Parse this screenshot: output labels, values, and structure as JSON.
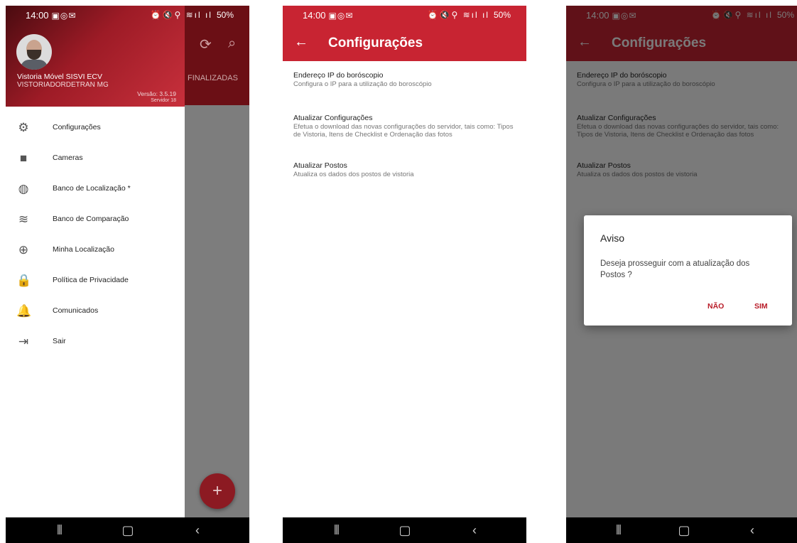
{
  "status": {
    "time": "14:00",
    "left_glyphs": "▣◎✉",
    "right_glyphs": "⏰🔇⚲ ≋ıl ıl",
    "battery": "50%"
  },
  "drawer": {
    "user_name": "Vistoria Móvel SISVI ECV",
    "user_org": "VISTORIADORDETRAN MG",
    "version": "Versão: 3.5.19",
    "server": "Servidor 18",
    "items": [
      {
        "label": "Configurações",
        "icon": "gear-icon",
        "glyph": "⚙"
      },
      {
        "label": "Cameras",
        "icon": "video-camera-icon",
        "glyph": "■"
      },
      {
        "label": "Banco de Localização *",
        "icon": "globe-icon",
        "glyph": "◍"
      },
      {
        "label": "Banco de Comparação",
        "icon": "database-icon",
        "glyph": "≋"
      },
      {
        "label": "Minha Localização",
        "icon": "crosshair-icon",
        "glyph": "⊕"
      },
      {
        "label": "Política de Privacidade",
        "icon": "lock-icon",
        "glyph": "🔒"
      },
      {
        "label": "Comunicados",
        "icon": "bell-icon",
        "glyph": "🔔"
      },
      {
        "label": "Sair",
        "icon": "logout-icon",
        "glyph": "⇥"
      }
    ]
  },
  "background_app": {
    "tab_label": "FINALIZADAS",
    "fab_label": "+"
  },
  "settings": {
    "title": "Configurações",
    "items": [
      {
        "title": "Endereço IP do boróscopio",
        "desc": "Configura o IP para a utilização do boroscópio"
      },
      {
        "title": "Atualizar Configurações",
        "desc": "Efetua o download das novas configurações do servidor, tais como: Tipos de Vistoria, Itens de Checklist e Ordenação das fotos"
      },
      {
        "title": "Atualizar Postos",
        "desc": "Atualiza os dados dos postos de vistoria"
      }
    ]
  },
  "dialog": {
    "title": "Aviso",
    "message": "Deseja prosseguir com a atualização dos Postos ?",
    "negative": "NÃO",
    "positive": "SIM"
  },
  "colors": {
    "primary": "#c82432",
    "accent_text": "#b81b27"
  }
}
